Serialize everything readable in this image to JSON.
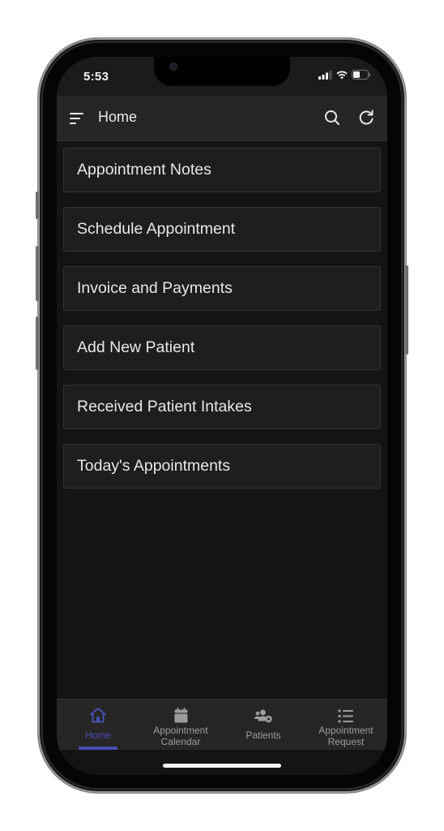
{
  "status_bar": {
    "time": "5:53",
    "icons": [
      "signal-icon",
      "wifi-icon",
      "battery-icon"
    ]
  },
  "header": {
    "title": "Home",
    "menu_icon": "menu-icon",
    "search_icon": "search-icon",
    "refresh_icon": "refresh-icon"
  },
  "menu": {
    "items": [
      {
        "label": "Appointment Notes"
      },
      {
        "label": "Schedule Appointment"
      },
      {
        "label": "Invoice and Payments"
      },
      {
        "label": "Add New Patient"
      },
      {
        "label": "Received Patient Intakes"
      },
      {
        "label": "Today's Appointments"
      }
    ]
  },
  "bottom_nav": {
    "active_color": "#4650b0",
    "items": [
      {
        "label": "Home",
        "icon": "home-icon",
        "active": true
      },
      {
        "label": "Appointment Calendar",
        "line1": "Appointment",
        "line2": "Calendar",
        "icon": "calendar-icon",
        "active": false
      },
      {
        "label": "Patients",
        "icon": "patients-icon",
        "active": false
      },
      {
        "label": "Appointment Request",
        "line1": "Appointment",
        "line2": "Request",
        "icon": "list-icon",
        "active": false
      }
    ]
  }
}
